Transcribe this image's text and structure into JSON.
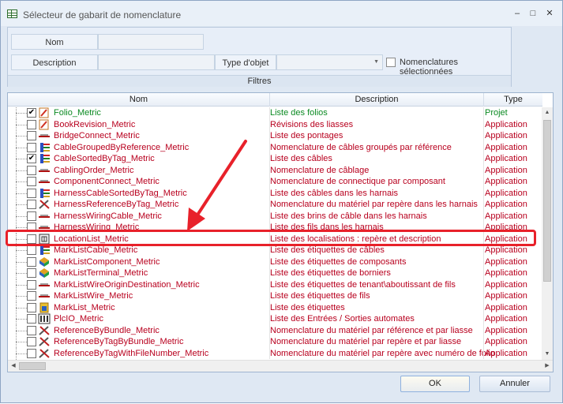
{
  "window": {
    "title": "Sélecteur de gabarit de nomenclature",
    "minimize": "–",
    "maximize": "□",
    "close": "✕"
  },
  "filters": {
    "nom_label": "Nom",
    "nom_value": "",
    "description_label": "Description",
    "description_value": "",
    "type_label": "Type d'objet",
    "type_value": "",
    "selected_label": "Nomenclatures sélectionnées",
    "selected_checked": false,
    "group_title": "Filtres"
  },
  "table": {
    "columns": [
      "Nom",
      "Description",
      "Type"
    ],
    "rows": [
      {
        "name": "Folio_Metric",
        "description": "Liste des folios",
        "type": "Projet",
        "checked": true,
        "icon": "folio-icon",
        "style": "green"
      },
      {
        "name": "BookRevision_Metric",
        "description": "Révisions des liasses",
        "type": "Application",
        "checked": false,
        "icon": "folio-icon",
        "style": "red"
      },
      {
        "name": "BridgeConnect_Metric",
        "description": "Liste des pontages",
        "type": "Application",
        "checked": false,
        "icon": "cable-icon",
        "style": "red"
      },
      {
        "name": "CableGroupedByReference_Metric",
        "description": "Nomenclature de câbles groupés par référence",
        "type": "Application",
        "checked": false,
        "icon": "cable-bundle-icon",
        "style": "red"
      },
      {
        "name": "CableSortedByTag_Metric",
        "description": "Liste des câbles",
        "type": "Application",
        "checked": true,
        "icon": "cable-bundle-icon",
        "style": "red"
      },
      {
        "name": "CablingOrder_Metric",
        "description": "Nomenclature de câblage",
        "type": "Application",
        "checked": false,
        "icon": "cable-icon",
        "style": "red"
      },
      {
        "name": "ComponentConnect_Metric",
        "description": "Nomenclature de connectique par composant",
        "type": "Application",
        "checked": false,
        "icon": "cable-icon",
        "style": "red"
      },
      {
        "name": "HarnessCableSortedByTag_Metric",
        "description": "Liste des câbles dans les harnais",
        "type": "Application",
        "checked": false,
        "icon": "cable-bundle-icon",
        "style": "red"
      },
      {
        "name": "HarnessReferenceByTag_Metric",
        "description": "Nomenclature du matériel par repère dans les harnais",
        "type": "Application",
        "checked": false,
        "icon": "tools-icon",
        "style": "red"
      },
      {
        "name": "HarnessWiringCable_Metric",
        "description": "Liste des brins de câble dans les harnais",
        "type": "Application",
        "checked": false,
        "icon": "cable-icon",
        "style": "red"
      },
      {
        "name": "HarnessWiring_Metric",
        "description": "Liste des fils dans les harnais",
        "type": "Application",
        "checked": false,
        "icon": "cable-icon",
        "style": "red"
      },
      {
        "name": "LocationList_Metric",
        "description": "Liste des localisations : repère et description",
        "type": "Application",
        "checked": false,
        "icon": "location-icon",
        "style": "red"
      },
      {
        "name": "MarkListCable_Metric",
        "description": "Liste des étiquettes de câbles",
        "type": "Application",
        "checked": false,
        "icon": "cable-bundle-icon",
        "style": "red"
      },
      {
        "name": "MarkListComponent_Metric",
        "description": "Liste des étiquettes de composants",
        "type": "Application",
        "checked": false,
        "icon": "components-icon",
        "style": "red"
      },
      {
        "name": "MarkListTerminal_Metric",
        "description": "Liste des étiquettes de borniers",
        "type": "Application",
        "checked": false,
        "icon": "components-icon",
        "style": "red"
      },
      {
        "name": "MarkListWireOriginDestination_Metric",
        "description": "Liste des étiquettes de tenant\\aboutissant de fils",
        "type": "Application",
        "checked": false,
        "icon": "cable-icon",
        "style": "red"
      },
      {
        "name": "MarkListWire_Metric",
        "description": "Liste des étiquettes de fils",
        "type": "Application",
        "checked": false,
        "icon": "cable-icon",
        "style": "red"
      },
      {
        "name": "MarkList_Metric",
        "description": "Liste des étiquettes",
        "type": "Application",
        "checked": false,
        "icon": "mark-icon",
        "style": "red"
      },
      {
        "name": "PlcIO_Metric",
        "description": "Liste des Entrées / Sorties automates",
        "type": "Application",
        "checked": false,
        "icon": "plc-icon",
        "style": "red"
      },
      {
        "name": "ReferenceByBundle_Metric",
        "description": "Nomenclature du matériel par référence et par liasse",
        "type": "Application",
        "checked": false,
        "icon": "tools-icon",
        "style": "red"
      },
      {
        "name": "ReferenceByTagByBundle_Metric",
        "description": "Nomenclature du matériel par repère et par liasse",
        "type": "Application",
        "checked": false,
        "icon": "tools-icon",
        "style": "red"
      },
      {
        "name": "ReferenceByTagWithFileNumber_Metric",
        "description": "Nomenclature du matériel par repère avec numéro de folio",
        "type": "Application",
        "checked": false,
        "icon": "tools-icon",
        "style": "red"
      }
    ]
  },
  "buttons": {
    "ok": "OK",
    "cancel": "Annuler"
  },
  "colors": {
    "accent_green": "#0b8a22",
    "name_red": "#b8001e",
    "annotation_red": "#e8212a"
  }
}
